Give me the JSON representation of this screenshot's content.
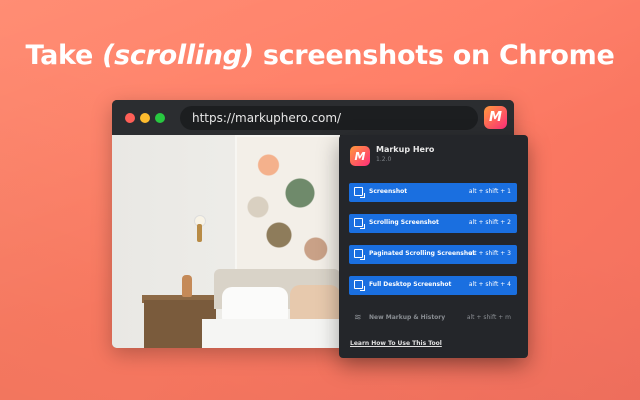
{
  "headline": {
    "part1": "Take ",
    "italic": "(scrolling)",
    "part2": " screenshots on Chrome"
  },
  "browser": {
    "url": "https://markuphero.com/",
    "extension_icon_letter": "M"
  },
  "popup": {
    "logo_letter": "M",
    "title": "Markup Hero",
    "version": "1.2.0",
    "actions": [
      {
        "label": "Screenshot",
        "shortcut": "alt + shift + 1",
        "icon": "screenshot-icon"
      },
      {
        "label": "Scrolling Screenshot",
        "shortcut": "alt + shift + 2",
        "icon": "scrolling-screenshot-icon"
      },
      {
        "label": "Paginated Scrolling Screenshot",
        "shortcut": "alt + shift + 3",
        "icon": "paginated-screenshot-icon"
      },
      {
        "label": "Full Desktop Screenshot",
        "shortcut": "alt + shift + 4",
        "icon": "desktop-screenshot-icon"
      },
      {
        "label": "New Markup & History",
        "shortcut": "alt + shift + m",
        "icon": "layers-icon"
      }
    ],
    "help_link": "Learn How To Use This Tool"
  },
  "colors": {
    "background": "#ff7b63",
    "action_blue": "#1a6fe0",
    "popup_bg": "#24262a",
    "browser_bg": "#222426"
  }
}
